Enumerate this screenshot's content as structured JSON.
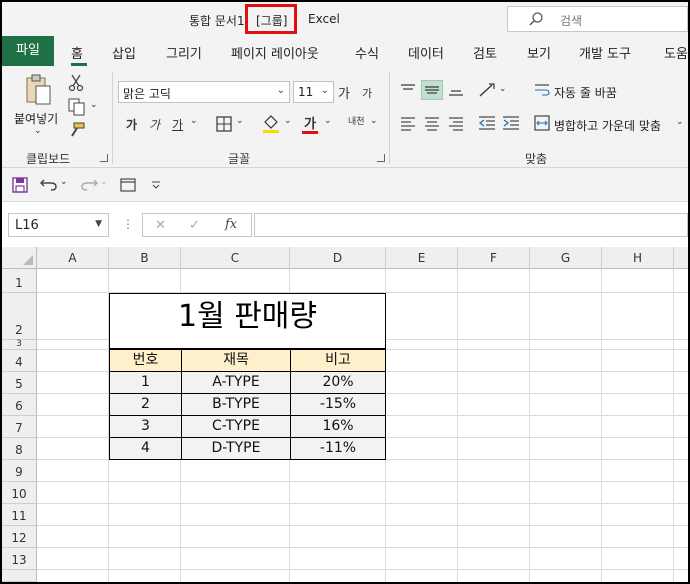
{
  "titlebar": {
    "doc_title": "통합 문서1",
    "group_tag": "[그룹]",
    "app_name": "Excel",
    "search_placeholder": "검색"
  },
  "tabs": {
    "file": "파일",
    "items": [
      "홈",
      "삽입",
      "그리기",
      "페이지 레이아웃",
      "수식",
      "데이터",
      "검토",
      "보기",
      "개발 도구",
      "도움"
    ]
  },
  "ribbon": {
    "clipboard": {
      "paste": "붙여넣기",
      "label": "클립보드"
    },
    "font": {
      "name": "맑은 고딕",
      "size": "11",
      "grow": "가",
      "shrink": "가",
      "bold": "가",
      "italic": "가",
      "underline": "가",
      "font_color_glyph": "가",
      "phonetic": "내천",
      "label": "글꼴"
    },
    "alignment": {
      "wrap_text": "자동 줄 바꿈",
      "merge_center": "병합하고 가운데 맞춤",
      "label": "맞춤"
    }
  },
  "formula_bar": {
    "name_box": "L16",
    "cancel": "✕",
    "enter": "✓",
    "fx": "fx",
    "formula": ""
  },
  "grid": {
    "columns": [
      "A",
      "B",
      "C",
      "D",
      "E",
      "F",
      "G",
      "H"
    ],
    "rows": [
      "1",
      "2",
      "3",
      "4",
      "5",
      "6",
      "7",
      "8",
      "9",
      "10",
      "11",
      "12",
      "13"
    ]
  },
  "sheet": {
    "title": "1월 판매량",
    "headers": [
      "번호",
      "재목",
      "비고"
    ],
    "rows": [
      [
        "1",
        "A-TYPE",
        "20%"
      ],
      [
        "2",
        "B-TYPE",
        "-15%"
      ],
      [
        "3",
        "C-TYPE",
        "16%"
      ],
      [
        "4",
        "D-TYPE",
        "-11%"
      ]
    ]
  },
  "colors": {
    "accent": "#1f7145",
    "highlight_border": "#e01010",
    "header_fill": "#fff0cc",
    "body_fill": "#f2f2f2"
  }
}
